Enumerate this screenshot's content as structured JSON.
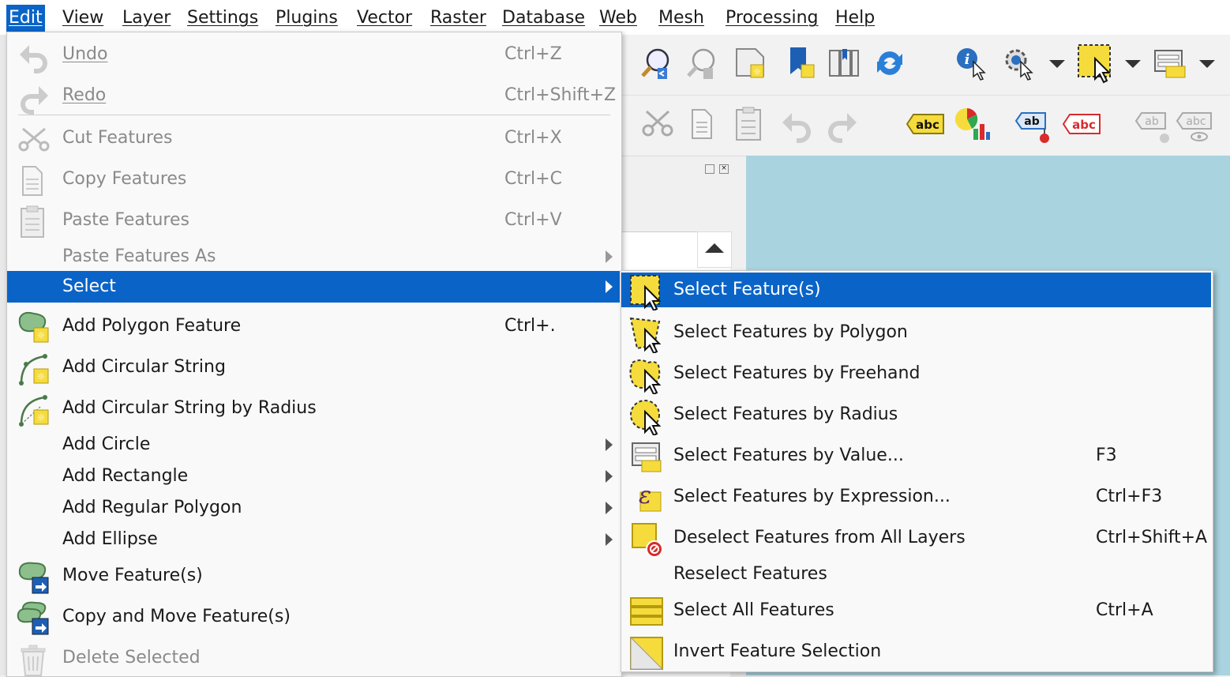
{
  "menubar": [
    {
      "label": "Edit"
    },
    {
      "label": "View"
    },
    {
      "label": "Layer"
    },
    {
      "label": "Settings"
    },
    {
      "label": "Plugins"
    },
    {
      "label": "Vector"
    },
    {
      "label": "Raster"
    },
    {
      "label": "Database"
    },
    {
      "label": "Web"
    },
    {
      "label": "Mesh"
    },
    {
      "label": "Processing"
    },
    {
      "label": "Help"
    }
  ],
  "edit_menu": {
    "undo": {
      "label": "Undo",
      "shortcut": "Ctrl+Z"
    },
    "redo": {
      "label": "Redo",
      "shortcut": "Ctrl+Shift+Z"
    },
    "cut": {
      "label": "Cut Features",
      "shortcut": "Ctrl+X"
    },
    "copy": {
      "label": "Copy Features",
      "shortcut": "Ctrl+C"
    },
    "paste": {
      "label": "Paste Features",
      "shortcut": "Ctrl+V"
    },
    "paste_as": {
      "label": "Paste Features As"
    },
    "select": {
      "label": "Select"
    },
    "add_polygon": {
      "label": "Add Polygon Feature",
      "shortcut": "Ctrl+."
    },
    "add_circular_string": {
      "label": "Add Circular String"
    },
    "add_circular_string_radius": {
      "label": "Add Circular String by Radius"
    },
    "add_circle": {
      "label": "Add Circle"
    },
    "add_rectangle": {
      "label": "Add Rectangle"
    },
    "add_regular_polygon": {
      "label": "Add Regular Polygon"
    },
    "add_ellipse": {
      "label": "Add Ellipse"
    },
    "move_features": {
      "label": "Move Feature(s)"
    },
    "copy_move_features": {
      "label": "Copy and Move Feature(s)"
    },
    "delete_selected": {
      "label": "Delete Selected"
    }
  },
  "select_submenu": {
    "select_features": {
      "label": "Select Feature(s)"
    },
    "by_polygon": {
      "label": "Select Features by Polygon"
    },
    "by_freehand": {
      "label": "Select Features by Freehand"
    },
    "by_radius": {
      "label": "Select Features by Radius"
    },
    "by_value": {
      "label": "Select Features by Value...",
      "shortcut": "F3"
    },
    "by_expression": {
      "label": "Select Features by Expression...",
      "shortcut": "Ctrl+F3"
    },
    "deselect_all": {
      "label": "Deselect Features from All Layers",
      "shortcut": "Ctrl+Shift+A"
    },
    "reselect": {
      "label": "Reselect Features"
    },
    "select_all": {
      "label": "Select All Features",
      "shortcut": "Ctrl+A"
    },
    "invert": {
      "label": "Invert Feature Selection"
    }
  },
  "toolbar": {
    "label_tool_text": "abc",
    "label_tool_text_short": "ab"
  },
  "colors": {
    "highlight": "#0a64c8",
    "selection_yellow": "#f5dc3c",
    "canvas": "#a9d3df"
  }
}
